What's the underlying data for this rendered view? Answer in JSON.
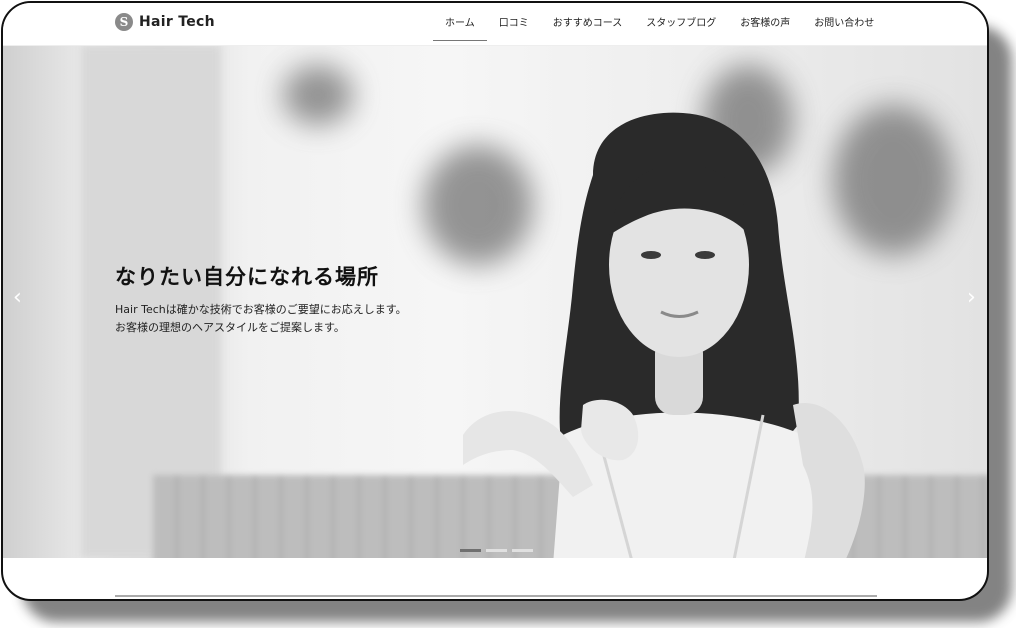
{
  "brand": {
    "name": "Hair Tech",
    "logo_glyph": "S",
    "logo_icon": "s-circle-icon"
  },
  "nav": {
    "items": [
      {
        "label": "ホーム",
        "active": true
      },
      {
        "label": "口コミ",
        "active": false
      },
      {
        "label": "おすすめコース",
        "active": false
      },
      {
        "label": "スタッフブログ",
        "active": false
      },
      {
        "label": "お客様の声",
        "active": false
      },
      {
        "label": "お問い合わせ",
        "active": false
      }
    ]
  },
  "hero": {
    "title": "なりたい自分になれる場所",
    "line1": "Hair Techは確かな技術でお客様のご要望にお応えします。",
    "line2": "お客様の理想のヘアスタイルをご提案します。",
    "prev_icon": "‹",
    "next_icon": "›",
    "slides": 3,
    "active_slide": 1
  },
  "colors": {
    "accent": "#111111",
    "muted": "#8a8a8a"
  }
}
